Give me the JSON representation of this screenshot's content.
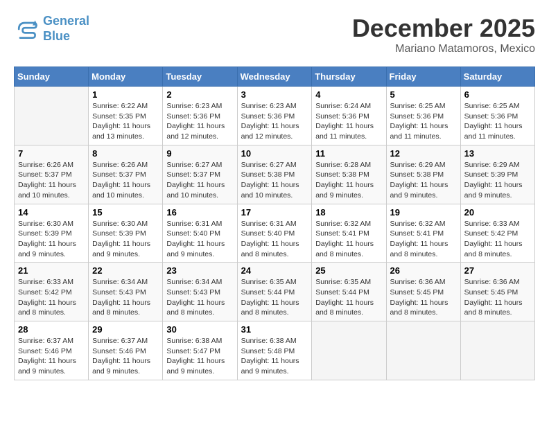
{
  "logo": {
    "line1": "General",
    "line2": "Blue"
  },
  "title": "December 2025",
  "subtitle": "Mariano Matamoros, Mexico",
  "days_of_week": [
    "Sunday",
    "Monday",
    "Tuesday",
    "Wednesday",
    "Thursday",
    "Friday",
    "Saturday"
  ],
  "weeks": [
    [
      {
        "day": "",
        "sunrise": "",
        "sunset": "",
        "daylight": "",
        "empty": true
      },
      {
        "day": "1",
        "sunrise": "Sunrise: 6:22 AM",
        "sunset": "Sunset: 5:35 PM",
        "daylight": "Daylight: 11 hours and 13 minutes.",
        "empty": false
      },
      {
        "day": "2",
        "sunrise": "Sunrise: 6:23 AM",
        "sunset": "Sunset: 5:36 PM",
        "daylight": "Daylight: 11 hours and 12 minutes.",
        "empty": false
      },
      {
        "day": "3",
        "sunrise": "Sunrise: 6:23 AM",
        "sunset": "Sunset: 5:36 PM",
        "daylight": "Daylight: 11 hours and 12 minutes.",
        "empty": false
      },
      {
        "day": "4",
        "sunrise": "Sunrise: 6:24 AM",
        "sunset": "Sunset: 5:36 PM",
        "daylight": "Daylight: 11 hours and 11 minutes.",
        "empty": false
      },
      {
        "day": "5",
        "sunrise": "Sunrise: 6:25 AM",
        "sunset": "Sunset: 5:36 PM",
        "daylight": "Daylight: 11 hours and 11 minutes.",
        "empty": false
      },
      {
        "day": "6",
        "sunrise": "Sunrise: 6:25 AM",
        "sunset": "Sunset: 5:36 PM",
        "daylight": "Daylight: 11 hours and 11 minutes.",
        "empty": false
      }
    ],
    [
      {
        "day": "7",
        "sunrise": "Sunrise: 6:26 AM",
        "sunset": "Sunset: 5:37 PM",
        "daylight": "Daylight: 11 hours and 10 minutes.",
        "empty": false
      },
      {
        "day": "8",
        "sunrise": "Sunrise: 6:26 AM",
        "sunset": "Sunset: 5:37 PM",
        "daylight": "Daylight: 11 hours and 10 minutes.",
        "empty": false
      },
      {
        "day": "9",
        "sunrise": "Sunrise: 6:27 AM",
        "sunset": "Sunset: 5:37 PM",
        "daylight": "Daylight: 11 hours and 10 minutes.",
        "empty": false
      },
      {
        "day": "10",
        "sunrise": "Sunrise: 6:27 AM",
        "sunset": "Sunset: 5:38 PM",
        "daylight": "Daylight: 11 hours and 10 minutes.",
        "empty": false
      },
      {
        "day": "11",
        "sunrise": "Sunrise: 6:28 AM",
        "sunset": "Sunset: 5:38 PM",
        "daylight": "Daylight: 11 hours and 9 minutes.",
        "empty": false
      },
      {
        "day": "12",
        "sunrise": "Sunrise: 6:29 AM",
        "sunset": "Sunset: 5:38 PM",
        "daylight": "Daylight: 11 hours and 9 minutes.",
        "empty": false
      },
      {
        "day": "13",
        "sunrise": "Sunrise: 6:29 AM",
        "sunset": "Sunset: 5:39 PM",
        "daylight": "Daylight: 11 hours and 9 minutes.",
        "empty": false
      }
    ],
    [
      {
        "day": "14",
        "sunrise": "Sunrise: 6:30 AM",
        "sunset": "Sunset: 5:39 PM",
        "daylight": "Daylight: 11 hours and 9 minutes.",
        "empty": false
      },
      {
        "day": "15",
        "sunrise": "Sunrise: 6:30 AM",
        "sunset": "Sunset: 5:39 PM",
        "daylight": "Daylight: 11 hours and 9 minutes.",
        "empty": false
      },
      {
        "day": "16",
        "sunrise": "Sunrise: 6:31 AM",
        "sunset": "Sunset: 5:40 PM",
        "daylight": "Daylight: 11 hours and 9 minutes.",
        "empty": false
      },
      {
        "day": "17",
        "sunrise": "Sunrise: 6:31 AM",
        "sunset": "Sunset: 5:40 PM",
        "daylight": "Daylight: 11 hours and 8 minutes.",
        "empty": false
      },
      {
        "day": "18",
        "sunrise": "Sunrise: 6:32 AM",
        "sunset": "Sunset: 5:41 PM",
        "daylight": "Daylight: 11 hours and 8 minutes.",
        "empty": false
      },
      {
        "day": "19",
        "sunrise": "Sunrise: 6:32 AM",
        "sunset": "Sunset: 5:41 PM",
        "daylight": "Daylight: 11 hours and 8 minutes.",
        "empty": false
      },
      {
        "day": "20",
        "sunrise": "Sunrise: 6:33 AM",
        "sunset": "Sunset: 5:42 PM",
        "daylight": "Daylight: 11 hours and 8 minutes.",
        "empty": false
      }
    ],
    [
      {
        "day": "21",
        "sunrise": "Sunrise: 6:33 AM",
        "sunset": "Sunset: 5:42 PM",
        "daylight": "Daylight: 11 hours and 8 minutes.",
        "empty": false
      },
      {
        "day": "22",
        "sunrise": "Sunrise: 6:34 AM",
        "sunset": "Sunset: 5:43 PM",
        "daylight": "Daylight: 11 hours and 8 minutes.",
        "empty": false
      },
      {
        "day": "23",
        "sunrise": "Sunrise: 6:34 AM",
        "sunset": "Sunset: 5:43 PM",
        "daylight": "Daylight: 11 hours and 8 minutes.",
        "empty": false
      },
      {
        "day": "24",
        "sunrise": "Sunrise: 6:35 AM",
        "sunset": "Sunset: 5:44 PM",
        "daylight": "Daylight: 11 hours and 8 minutes.",
        "empty": false
      },
      {
        "day": "25",
        "sunrise": "Sunrise: 6:35 AM",
        "sunset": "Sunset: 5:44 PM",
        "daylight": "Daylight: 11 hours and 8 minutes.",
        "empty": false
      },
      {
        "day": "26",
        "sunrise": "Sunrise: 6:36 AM",
        "sunset": "Sunset: 5:45 PM",
        "daylight": "Daylight: 11 hours and 8 minutes.",
        "empty": false
      },
      {
        "day": "27",
        "sunrise": "Sunrise: 6:36 AM",
        "sunset": "Sunset: 5:45 PM",
        "daylight": "Daylight: 11 hours and 8 minutes.",
        "empty": false
      }
    ],
    [
      {
        "day": "28",
        "sunrise": "Sunrise: 6:37 AM",
        "sunset": "Sunset: 5:46 PM",
        "daylight": "Daylight: 11 hours and 9 minutes.",
        "empty": false
      },
      {
        "day": "29",
        "sunrise": "Sunrise: 6:37 AM",
        "sunset": "Sunset: 5:46 PM",
        "daylight": "Daylight: 11 hours and 9 minutes.",
        "empty": false
      },
      {
        "day": "30",
        "sunrise": "Sunrise: 6:38 AM",
        "sunset": "Sunset: 5:47 PM",
        "daylight": "Daylight: 11 hours and 9 minutes.",
        "empty": false
      },
      {
        "day": "31",
        "sunrise": "Sunrise: 6:38 AM",
        "sunset": "Sunset: 5:48 PM",
        "daylight": "Daylight: 11 hours and 9 minutes.",
        "empty": false
      },
      {
        "day": "",
        "sunrise": "",
        "sunset": "",
        "daylight": "",
        "empty": true
      },
      {
        "day": "",
        "sunrise": "",
        "sunset": "",
        "daylight": "",
        "empty": true
      },
      {
        "day": "",
        "sunrise": "",
        "sunset": "",
        "daylight": "",
        "empty": true
      }
    ]
  ]
}
